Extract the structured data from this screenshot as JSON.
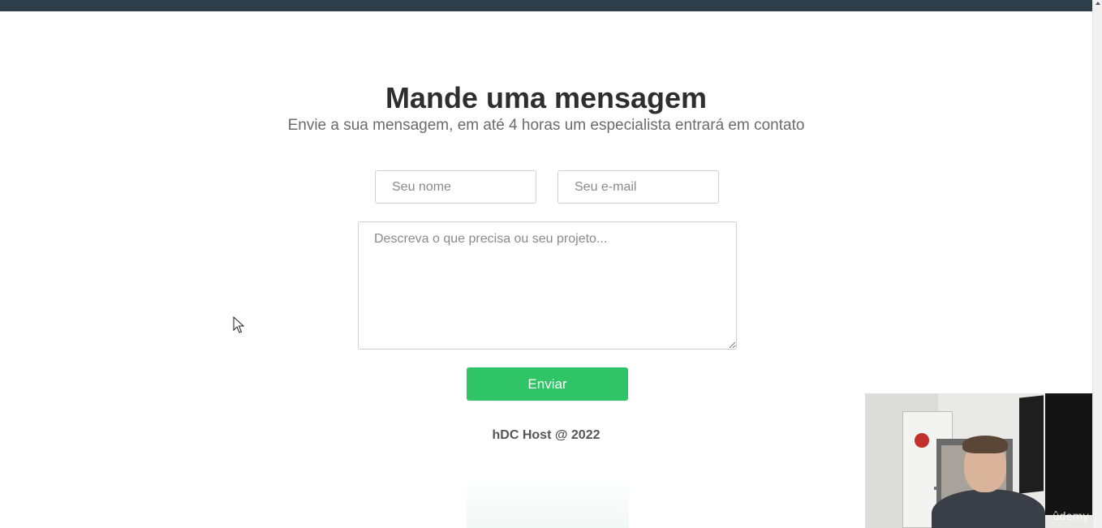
{
  "contact": {
    "title": "Mande uma mensagem",
    "subtitle": "Envie a sua mensagem, em até 4 horas um especialista entrará em contato",
    "name_placeholder": "Seu nome",
    "email_placeholder": "Seu e-mail",
    "message_placeholder": "Descreva o que precisa ou seu projeto...",
    "submit_label": "Enviar"
  },
  "footer": {
    "text": "hDC Host @ 2022"
  },
  "webcam": {
    "watermark": "ûdemy"
  },
  "colors": {
    "topbar": "#2f3e4b",
    "submit": "#2fc567",
    "title": "#2e2e2e",
    "subtitle": "#6b6b6b"
  },
  "icons": {
    "cursor": "mouse-pointer-icon",
    "scroll_up": "scroll-up-arrow-icon"
  }
}
